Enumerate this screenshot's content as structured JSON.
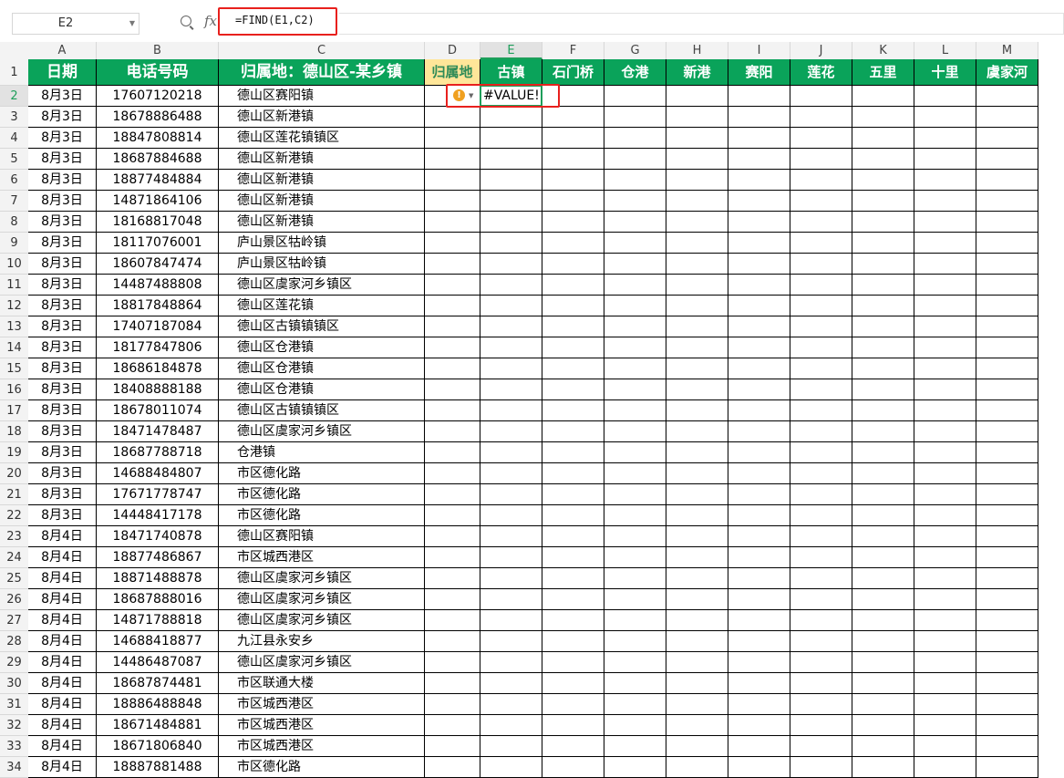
{
  "formula_bar": {
    "name_box": "E2",
    "fx_label": "fx",
    "formula": "=FIND(E1,C2)"
  },
  "columns": [
    "A",
    "B",
    "C",
    "D",
    "E",
    "F",
    "G",
    "H",
    "I",
    "J",
    "K",
    "L",
    "M"
  ],
  "active_column": "E",
  "active_row": 2,
  "header_row": {
    "A": "日期",
    "B": "电话号码",
    "C": "归属地：德山区-某乡镇",
    "D": "归属地",
    "E": "古镇",
    "F": "石门桥",
    "G": "仓港",
    "H": "新港",
    "I": "赛阳",
    "J": "莲花",
    "K": "五里",
    "L": "十里",
    "M": "虞家河"
  },
  "error_value": "#VALUE!",
  "error_indicator": "!",
  "rows": [
    {
      "num": 2,
      "date": "8月3日",
      "phone": "17607120218",
      "place": "德山区赛阳镇"
    },
    {
      "num": 3,
      "date": "8月3日",
      "phone": "18678886488",
      "place": "德山区新港镇"
    },
    {
      "num": 4,
      "date": "8月3日",
      "phone": "18847808814",
      "place": "德山区莲花镇镇区"
    },
    {
      "num": 5,
      "date": "8月3日",
      "phone": "18687884688",
      "place": "德山区新港镇"
    },
    {
      "num": 6,
      "date": "8月3日",
      "phone": "18877484884",
      "place": "德山区新港镇"
    },
    {
      "num": 7,
      "date": "8月3日",
      "phone": "14871864106",
      "place": "德山区新港镇"
    },
    {
      "num": 8,
      "date": "8月3日",
      "phone": "18168817048",
      "place": "德山区新港镇"
    },
    {
      "num": 9,
      "date": "8月3日",
      "phone": "18117076001",
      "place": "庐山景区牯岭镇"
    },
    {
      "num": 10,
      "date": "8月3日",
      "phone": "18607847474",
      "place": "庐山景区牯岭镇"
    },
    {
      "num": 11,
      "date": "8月3日",
      "phone": "14487488808",
      "place": "德山区虞家河乡镇区"
    },
    {
      "num": 12,
      "date": "8月3日",
      "phone": "18817848864",
      "place": "德山区莲花镇"
    },
    {
      "num": 13,
      "date": "8月3日",
      "phone": "17407187084",
      "place": "德山区古镇镇镇区"
    },
    {
      "num": 14,
      "date": "8月3日",
      "phone": "18177847806",
      "place": "德山区仓港镇"
    },
    {
      "num": 15,
      "date": "8月3日",
      "phone": "18686184878",
      "place": "德山区仓港镇"
    },
    {
      "num": 16,
      "date": "8月3日",
      "phone": "18408888188",
      "place": "德山区仓港镇"
    },
    {
      "num": 17,
      "date": "8月3日",
      "phone": "18678011074",
      "place": "德山区古镇镇镇区"
    },
    {
      "num": 18,
      "date": "8月3日",
      "phone": "18471478487",
      "place": "德山区虞家河乡镇区"
    },
    {
      "num": 19,
      "date": "8月3日",
      "phone": "18687788718",
      "place": "仓港镇"
    },
    {
      "num": 20,
      "date": "8月3日",
      "phone": "14688484807",
      "place": "市区德化路"
    },
    {
      "num": 21,
      "date": "8月3日",
      "phone": "17671778747",
      "place": "市区德化路"
    },
    {
      "num": 22,
      "date": "8月3日",
      "phone": "14448417178",
      "place": "市区德化路"
    },
    {
      "num": 23,
      "date": "8月4日",
      "phone": "18471740878",
      "place": "德山区赛阳镇"
    },
    {
      "num": 24,
      "date": "8月4日",
      "phone": "18877486867",
      "place": "市区城西港区"
    },
    {
      "num": 25,
      "date": "8月4日",
      "phone": "18871488878",
      "place": "德山区虞家河乡镇区"
    },
    {
      "num": 26,
      "date": "8月4日",
      "phone": "18687888016",
      "place": "德山区虞家河乡镇区"
    },
    {
      "num": 27,
      "date": "8月4日",
      "phone": "14871788818",
      "place": "德山区虞家河乡镇区"
    },
    {
      "num": 28,
      "date": "8月4日",
      "phone": "14688418877",
      "place": "九江县永安乡"
    },
    {
      "num": 29,
      "date": "8月4日",
      "phone": "14486487087",
      "place": "德山区虞家河乡镇区"
    },
    {
      "num": 30,
      "date": "8月4日",
      "phone": "18687874481",
      "place": "市区联通大楼"
    },
    {
      "num": 31,
      "date": "8月4日",
      "phone": "18886488848",
      "place": "市区城西港区"
    },
    {
      "num": 32,
      "date": "8月4日",
      "phone": "18671484881",
      "place": "市区城西港区"
    },
    {
      "num": 33,
      "date": "8月4日",
      "phone": "18671806840",
      "place": "市区城西港区"
    },
    {
      "num": 34,
      "date": "8月4日",
      "phone": "18887881488",
      "place": "市区德化路"
    }
  ]
}
